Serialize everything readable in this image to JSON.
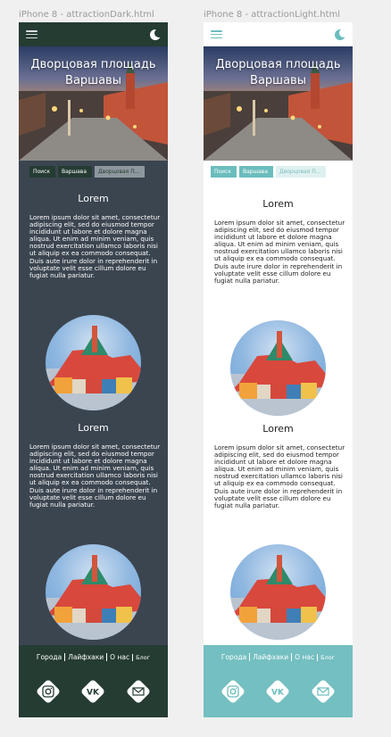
{
  "frames": [
    {
      "label": "iPhone 8 - attractionDark.html",
      "theme": "dark",
      "colors": {
        "background": "#3b4550",
        "header": "#253c33",
        "footer": "#253c33",
        "icon": "#253c33"
      },
      "hero_title": "Дворцовая площадь Варшавы",
      "breadcrumbs": [
        "Поиск",
        "Варшава",
        "Дворцовая П..."
      ],
      "sections": [
        {
          "title": "Lorem",
          "text": "Lorem ipsum dolor sit amet, consectetur adipiscing elit, sed do eiusmod tempor incididunt ut labore et dolore magna aliqua. Ut enim ad minim veniam, quis nostrud exercitation ullamco laboris nisi ut aliquip ex ea commodo consequat. Duis aute irure dolor in reprehenderit in voluptate velit esse cillum dolore eu fugiat nulla pariatur."
        },
        {
          "title": "Lorem",
          "text": "Lorem ipsum dolor sit amet, consectetur adipiscing elit, sed do eiusmod tempor incididunt ut labore et dolore magna aliqua. Ut enim ad minim veniam, quis nostrud exercitation ullamco laboris nisi ut aliquip ex ea commodo consequat. Duis aute irure dolor in reprehenderit in voluptate velit esse cillum dolore eu fugiat nulla pariatur."
        }
      ],
      "footer_nav": [
        "Города",
        "Лайфхаки",
        "О нас",
        "Блог"
      ],
      "socials": [
        "instagram-icon",
        "vk-icon",
        "mail-icon"
      ]
    },
    {
      "label": "iPhone 8 - attractionLight.html",
      "theme": "light",
      "colors": {
        "background": "#ffffff",
        "header": "#ffffff",
        "footer": "#74bfc1",
        "icon": "#6bbdbd"
      },
      "hero_title": "Дворцовая площадь Варшавы",
      "breadcrumbs": [
        "Поиск",
        "Варшава",
        "Дворцовая П..."
      ],
      "sections": [
        {
          "title": "Lorem",
          "text": "Lorem ipsum dolor sit amet, consectetur adipiscing elit, sed do eiusmod tempor incididunt ut labore et dolore magna aliqua. Ut enim ad minim veniam, quis nostrud exercitation ullamco laboris nisi ut aliquip ex ea commodo consequat. Duis aute irure dolor in reprehenderit in voluptate velit esse cillum dolore eu fugiat nulla pariatur."
        },
        {
          "title": "Lorem",
          "text": "Lorem ipsum dolor sit amet, consectetur adipiscing elit, sed do eiusmod tempor incididunt ut labore et dolore magna aliqua. Ut enim ad minim veniam, quis nostrud exercitation ullamco laboris nisi ut aliquip ex ea commodo consequat. Duis aute irure dolor in reprehenderit in voluptate velit esse cillum dolore eu fugiat nulla pariatur."
        }
      ],
      "footer_nav": [
        "Города",
        "Лайфхаки",
        "О нас",
        "Блог"
      ],
      "socials": [
        "instagram-icon",
        "vk-icon",
        "mail-icon"
      ]
    }
  ]
}
